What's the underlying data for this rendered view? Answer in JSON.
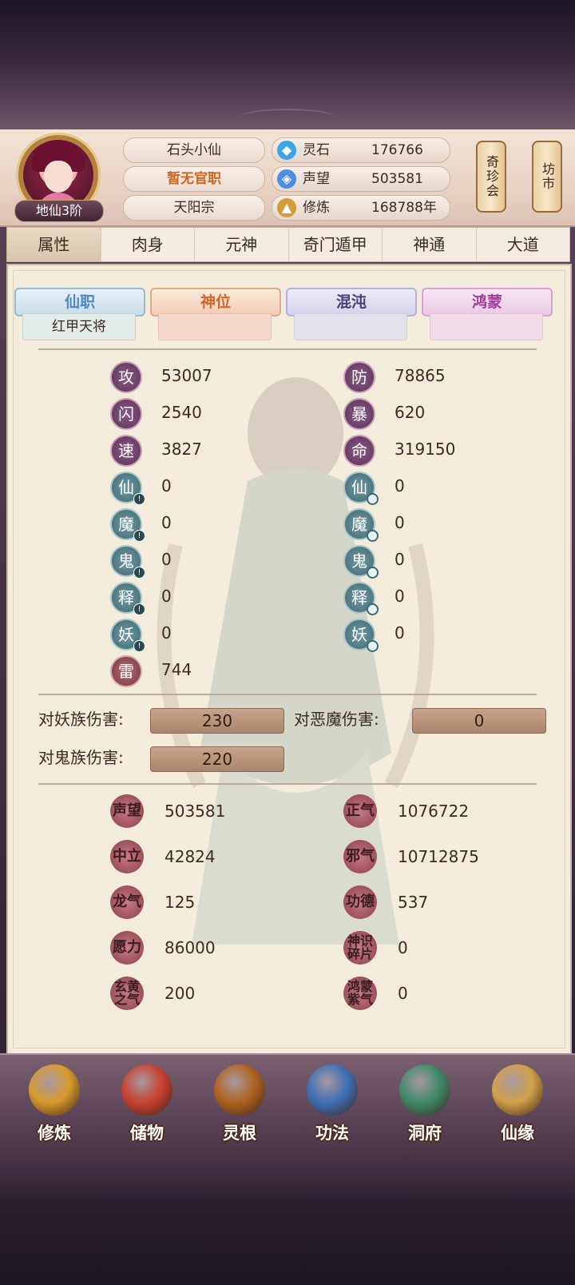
{
  "header": {
    "rank": "地仙3阶",
    "name": "石头小仙",
    "official": "暂无官职",
    "sect": "天阳宗",
    "resources": [
      {
        "label": "灵石",
        "value": "176766",
        "icon": "spirit-stone-icon",
        "color": "#3aa6e6"
      },
      {
        "label": "声望",
        "value": "503581",
        "icon": "reputation-icon",
        "color": "#4a8fe0"
      },
      {
        "label": "修炼",
        "value": "168788年",
        "icon": "meditation-icon",
        "color": "#d79a3a"
      }
    ],
    "side_buttons": [
      "奇珍会",
      "坊市"
    ]
  },
  "tabs": [
    "属性",
    "肉身",
    "元神",
    "奇门遁甲",
    "神通",
    "大道"
  ],
  "rank_tabs": [
    {
      "label": "仙职",
      "sub": "红甲天将",
      "color": "#4f86c4"
    },
    {
      "label": "神位",
      "sub": "",
      "color": "#d2672a"
    },
    {
      "label": "混沌",
      "sub": "",
      "color": "#4a3d7a"
    },
    {
      "label": "鸿蒙",
      "sub": "",
      "color": "#a03f9a"
    }
  ],
  "stats_left": [
    {
      "icon": "攻",
      "value": "53007",
      "kind": "purple"
    },
    {
      "icon": "闪",
      "value": "2540",
      "kind": "purple"
    },
    {
      "icon": "速",
      "value": "3827",
      "kind": "purple"
    },
    {
      "icon": "仙",
      "value": "0",
      "kind": "teal",
      "mark": "!"
    },
    {
      "icon": "魔",
      "value": "0",
      "kind": "teal",
      "mark": "!"
    },
    {
      "icon": "鬼",
      "value": "0",
      "kind": "teal",
      "mark": "!"
    },
    {
      "icon": "释",
      "value": "0",
      "kind": "teal",
      "mark": "!"
    },
    {
      "icon": "妖",
      "value": "0",
      "kind": "teal",
      "mark": "!"
    },
    {
      "icon": "雷",
      "value": "744",
      "kind": "red"
    }
  ],
  "stats_right": [
    {
      "icon": "防",
      "value": "78865",
      "kind": "purple"
    },
    {
      "icon": "暴",
      "value": "620",
      "kind": "purple"
    },
    {
      "icon": "命",
      "value": "319150",
      "kind": "purple"
    },
    {
      "icon": "仙",
      "value": "0",
      "kind": "teal",
      "mark": "o"
    },
    {
      "icon": "魔",
      "value": "0",
      "kind": "teal",
      "mark": "o"
    },
    {
      "icon": "鬼",
      "value": "0",
      "kind": "teal",
      "mark": "o"
    },
    {
      "icon": "释",
      "value": "0",
      "kind": "teal",
      "mark": "o"
    },
    {
      "icon": "妖",
      "value": "0",
      "kind": "teal",
      "mark": "o"
    }
  ],
  "damage": {
    "demon_label": "对妖族伤害:",
    "demon_value": "230",
    "evil_label": "对恶魔伤害:",
    "evil_value": "0",
    "ghost_label": "对鬼族伤害:",
    "ghost_value": "220"
  },
  "reputation_left": [
    {
      "icon": "声望",
      "value": "503581"
    },
    {
      "icon": "中立",
      "value": "42824"
    },
    {
      "icon": "龙气",
      "value": "125"
    },
    {
      "icon": "愿力",
      "value": "86000"
    },
    {
      "icon": "玄黄之气",
      "value": "200"
    }
  ],
  "reputation_right": [
    {
      "icon": "正气",
      "value": "1076722"
    },
    {
      "icon": "邪气",
      "value": "10712875"
    },
    {
      "icon": "功德",
      "value": "537"
    },
    {
      "icon": "神识碎片",
      "value": "0"
    },
    {
      "icon": "鸿蒙紫气",
      "value": "0"
    }
  ],
  "bottom_nav": [
    {
      "label": "修炼",
      "icon": "cultivation-icon",
      "color": "#d99a2e"
    },
    {
      "label": "储物",
      "icon": "storage-bag-icon",
      "color": "#c8422f"
    },
    {
      "label": "灵根",
      "icon": "spirit-root-icon",
      "color": "#b0631f"
    },
    {
      "label": "功法",
      "icon": "technique-book-icon",
      "color": "#3f6fb5"
    },
    {
      "label": "洞府",
      "icon": "cave-dwelling-icon",
      "color": "#3f8a6a"
    },
    {
      "label": "仙缘",
      "icon": "fate-gourd-icon",
      "color": "#d3a14a"
    }
  ]
}
